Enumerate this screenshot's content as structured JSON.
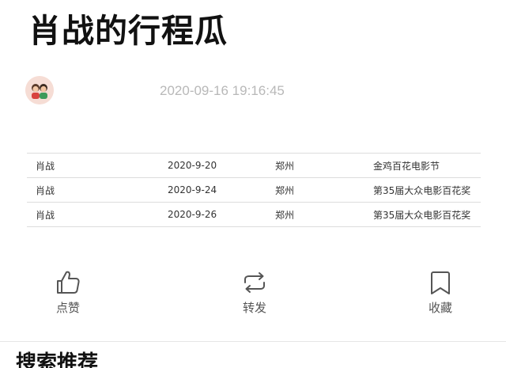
{
  "article": {
    "title": "肖战的行程瓜",
    "timestamp": "2020-09-16 19:16:45"
  },
  "schedule": {
    "rows": [
      {
        "name": "肖战",
        "date": "2020-9-20",
        "city": "郑州",
        "event": "金鸡百花电影节"
      },
      {
        "name": "肖战",
        "date": "2020-9-24",
        "city": "郑州",
        "event": "第35届大众电影百花奖"
      },
      {
        "name": "肖战",
        "date": "2020-9-26",
        "city": "郑州",
        "event": "第35届大众电影百花奖"
      }
    ]
  },
  "actions": {
    "like": {
      "label": "点赞",
      "icon": "thumbs-up-icon"
    },
    "share": {
      "label": "转发",
      "icon": "repost-icon"
    },
    "favorite": {
      "label": "收藏",
      "icon": "bookmark-icon"
    }
  },
  "recommend": {
    "title": "搜索推荐"
  }
}
